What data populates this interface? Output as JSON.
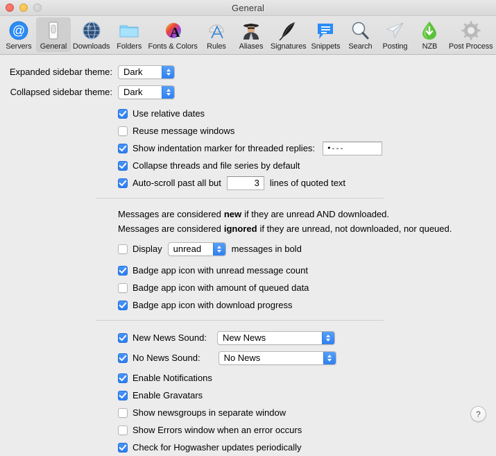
{
  "window": {
    "title": "General",
    "traffic_lights": [
      "close",
      "minimize",
      "zoom"
    ]
  },
  "toolbar": {
    "selected": "General",
    "items": [
      {
        "label": "Servers",
        "icon": "at-sign-icon"
      },
      {
        "label": "General",
        "icon": "toggle-switch-icon"
      },
      {
        "label": "Downloads",
        "icon": "globe-icon"
      },
      {
        "label": "Folders",
        "icon": "folder-icon"
      },
      {
        "label": "Fonts & Colors",
        "icon": "font-colors-icon"
      },
      {
        "label": "Rules",
        "icon": "ruler-protractor-icon"
      },
      {
        "label": "Aliases",
        "icon": "spy-person-icon"
      },
      {
        "label": "Signatures",
        "icon": "quill-feather-icon"
      },
      {
        "label": "Snippets",
        "icon": "speech-bubble-icon"
      },
      {
        "label": "Search",
        "icon": "magnifier-icon"
      },
      {
        "label": "Posting",
        "icon": "paper-plane-icon"
      },
      {
        "label": "NZB",
        "icon": "green-download-drop-icon"
      },
      {
        "label": "Post Process",
        "icon": "gear-icon"
      }
    ]
  },
  "main": {
    "expanded_sidebar": {
      "label": "Expanded sidebar theme:",
      "value": "Dark"
    },
    "collapsed_sidebar": {
      "label": "Collapsed sidebar theme:",
      "value": "Dark"
    },
    "use_relative_dates": {
      "label": "Use relative dates",
      "checked": true
    },
    "reuse_message_windows": {
      "label": "Reuse message windows",
      "checked": false
    },
    "indentation_marker": {
      "label": "Show indentation marker for threaded replies:",
      "checked": true,
      "value": "•---"
    },
    "collapse_threads": {
      "label": "Collapse threads and file series by default",
      "checked": true
    },
    "auto_scroll": {
      "checked": true,
      "label_before": "Auto-scroll past all but",
      "value": "3",
      "label_after": "lines of quoted text"
    },
    "info_new": {
      "prefix": "Messages are considered",
      "keyword": "new",
      "suffix": "if they are unread AND downloaded."
    },
    "info_ignored": {
      "prefix": "Messages are considered",
      "keyword": "ignored",
      "suffix": "if they are unread, not downloaded, nor queued."
    },
    "display_bold": {
      "checked": false,
      "label_before": "Display",
      "value": "unread",
      "label_after": "messages in bold"
    },
    "badge_unread": {
      "label": "Badge app icon with unread message count",
      "checked": true
    },
    "badge_queued": {
      "label": "Badge app icon with amount of queued data",
      "checked": false
    },
    "badge_progress": {
      "label": "Badge app icon with download progress",
      "checked": true
    },
    "new_news_sound": {
      "label": "New News Sound:",
      "checked": true,
      "value": "New News"
    },
    "no_news_sound": {
      "label": "No News Sound:",
      "checked": true,
      "value": "No News"
    },
    "enable_notifications": {
      "label": "Enable Notifications",
      "checked": true
    },
    "enable_gravatars": {
      "label": "Enable Gravatars",
      "checked": true
    },
    "show_newsgroups_separate": {
      "label": "Show newsgroups in separate window",
      "checked": false
    },
    "show_errors_window": {
      "label": "Show Errors window when an error occurs",
      "checked": false
    },
    "check_updates": {
      "label": "Check for Hogwasher updates periodically",
      "checked": true
    },
    "help_button": {
      "label": "?"
    }
  },
  "colors": {
    "accent_blue": "#2f80f0",
    "window_bg": "#ececec",
    "toolbar_bg": "#dedede",
    "separator": "#d0d0d0"
  }
}
